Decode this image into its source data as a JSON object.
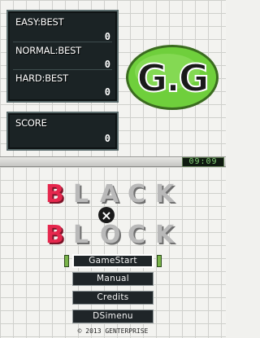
{
  "top_screen": {
    "best_scores": [
      {
        "label": "EASY:BEST",
        "value": "0"
      },
      {
        "label": "NORMAL:BEST",
        "value": "0"
      },
      {
        "label": "HARD:BEST",
        "value": "0"
      }
    ],
    "score": {
      "label": "SCORE",
      "value": "0"
    },
    "logo_text": "G.G"
  },
  "clock": "09:09",
  "title": {
    "word1": "BLACK",
    "separator": "×",
    "word2": "BLOCK"
  },
  "menu": {
    "items": [
      "GameStart",
      "Manual",
      "Credits",
      "DSimenu"
    ],
    "selected_index": 0
  },
  "copyright": "© 2013 GENTERPRISE",
  "colors": {
    "logo_green": "#6fcf3c",
    "title_red": "#e5274d",
    "title_gray": "#b9b9b9"
  }
}
